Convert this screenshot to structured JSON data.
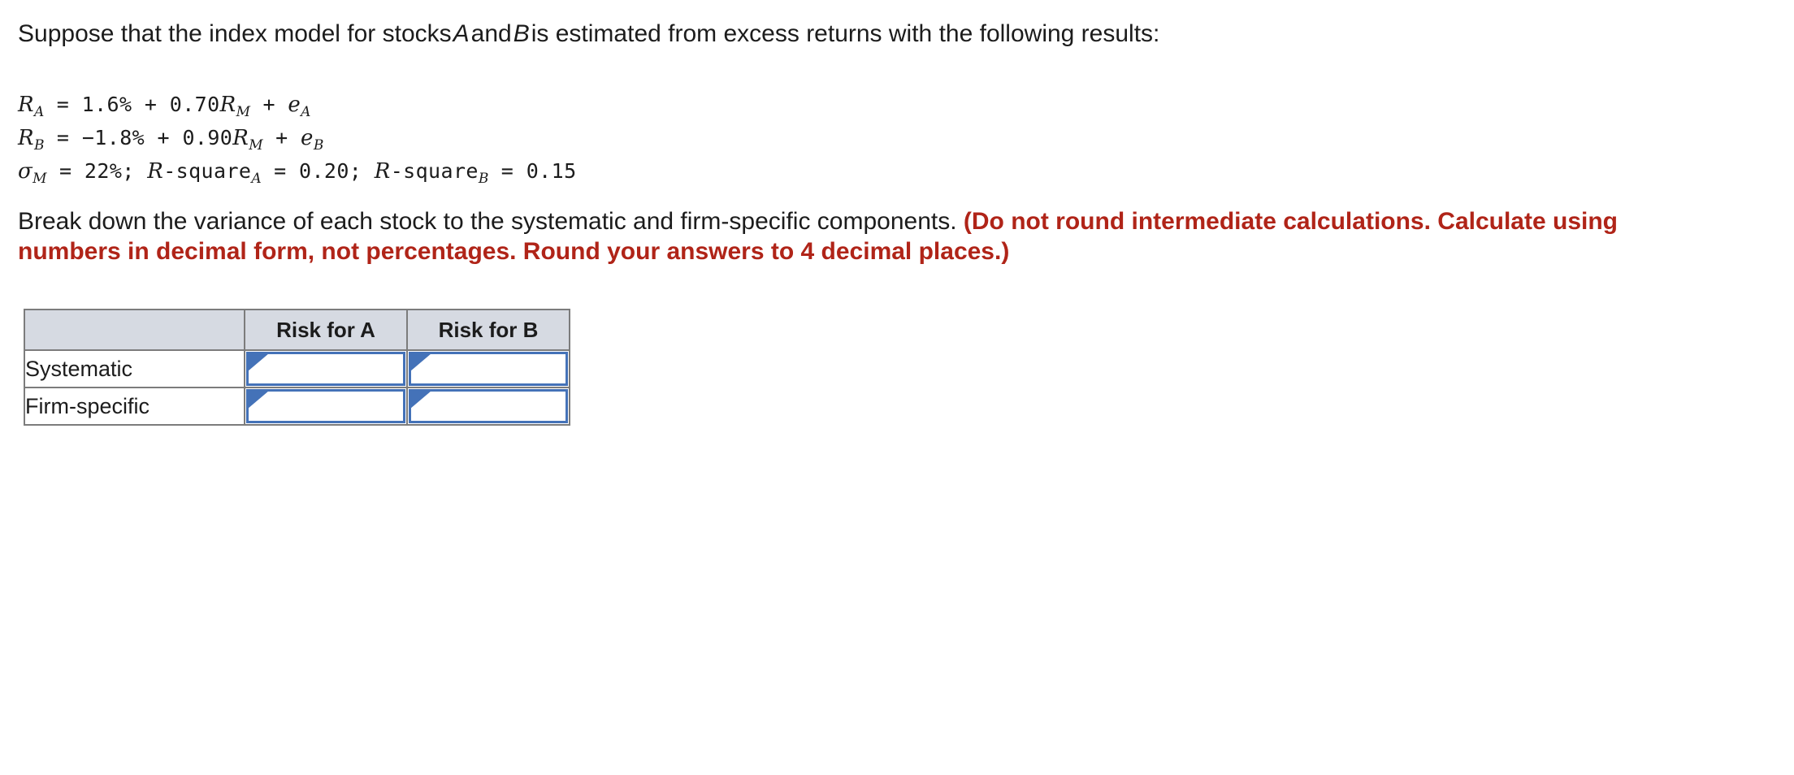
{
  "intro": {
    "part1": "Suppose that the index model for stocks",
    "stock_a": "A",
    "part2": "and",
    "stock_b": "B",
    "part3": "is estimated from excess returns with the following results:"
  },
  "equations": {
    "line1": {
      "lhs_var": "R",
      "lhs_sub": "A",
      "eq": " = 1.6% + 0.70",
      "term_var": "R",
      "term_sub": "M",
      "plus": " + ",
      "err_var": "e",
      "err_sub": "A"
    },
    "line2": {
      "lhs_var": "R",
      "lhs_sub": "B",
      "eq": " = −1.8% + 0.90",
      "term_var": "R",
      "term_sub": "M",
      "plus": " + ",
      "err_var": "e",
      "err_sub": "B"
    },
    "line3": {
      "sigma_var": "σ",
      "sigma_sub": "M",
      "sigma_val": " = 22%;  ",
      "rsq_a_var": "R",
      "rsq_a_text": "-square",
      "rsq_a_sub": "A",
      "rsq_a_val": " = 0.20;  ",
      "rsq_b_var": "R",
      "rsq_b_text": "-square",
      "rsq_b_sub": "B",
      "rsq_b_val": " = 0.15"
    }
  },
  "prompt": {
    "question": "Break down the variance of each stock to the systematic and firm-specific components. ",
    "emphasis": "(Do not round intermediate calculations. Calculate using numbers in decimal form, not percentages. Round your answers to 4 decimal places.)"
  },
  "table": {
    "headers": {
      "blank": "",
      "risk_a": "Risk for A",
      "risk_b": "Risk for B"
    },
    "rows": [
      {
        "label": "Systematic",
        "risk_a_value": "",
        "risk_b_value": ""
      },
      {
        "label": "Firm-specific",
        "risk_a_value": "",
        "risk_b_value": ""
      }
    ]
  },
  "colors": {
    "header_fill": "#d6dae2",
    "table_border": "#7c7c7c",
    "input_border": "#4472b8",
    "emphasis_red": "#b02418",
    "text": "#1c1c1c"
  }
}
